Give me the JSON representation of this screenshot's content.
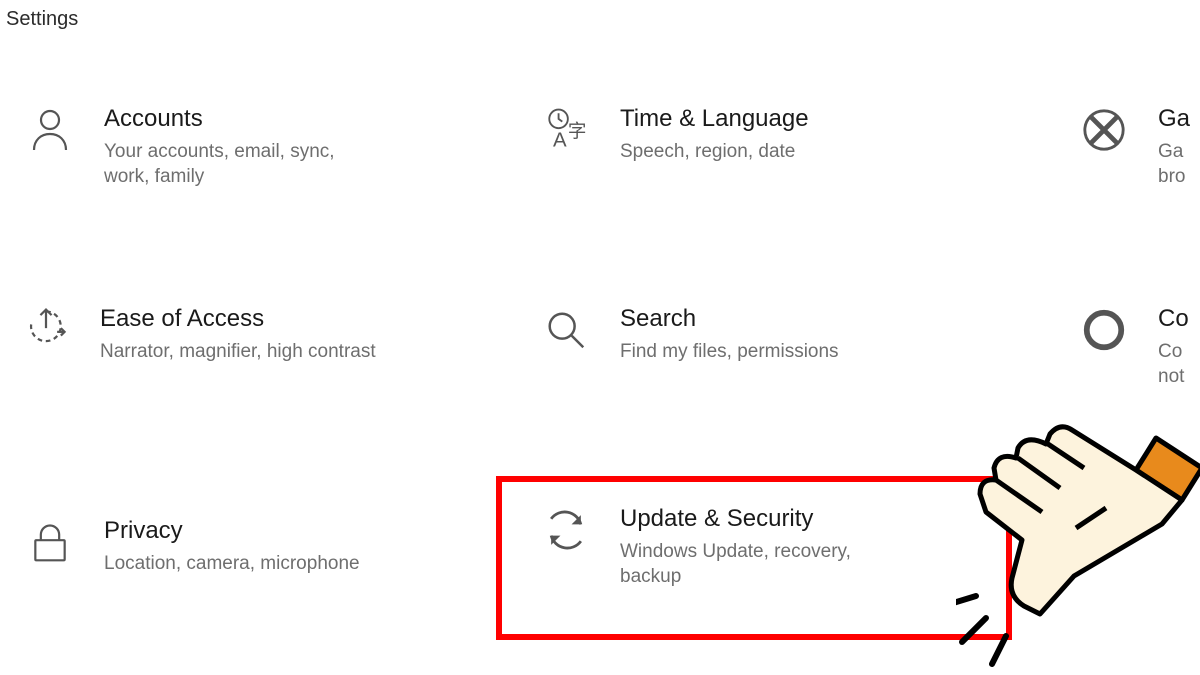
{
  "window_title": "Settings",
  "tiles": {
    "accounts": {
      "title": "Accounts",
      "desc": "Your accounts, email, sync, work, family"
    },
    "time": {
      "title": "Time & Language",
      "desc": "Speech, region, date"
    },
    "gaming": {
      "title": "Ga",
      "desc": "Ga\nbro"
    },
    "ease": {
      "title": "Ease of Access",
      "desc": "Narrator, magnifier, high contrast"
    },
    "search": {
      "title": "Search",
      "desc": "Find my files, permissions"
    },
    "cortana": {
      "title": "Co",
      "desc": "Co\nnot"
    },
    "privacy": {
      "title": "Privacy",
      "desc": "Location, camera, microphone"
    },
    "update": {
      "title": "Update & Security",
      "desc": "Windows Update, recovery, backup"
    }
  }
}
